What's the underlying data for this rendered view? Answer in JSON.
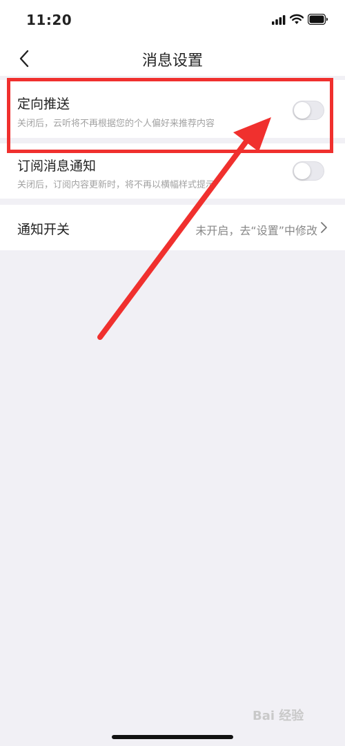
{
  "status": {
    "time": "11:20"
  },
  "nav": {
    "title": "消息设置"
  },
  "settings": {
    "targeted_push": {
      "title": "定向推送",
      "desc": "关闭后，云听将不再根据您的个人偏好来推荐内容",
      "enabled": false
    },
    "subscription_notice": {
      "title": "订阅消息通知",
      "desc": "关闭后，订阅内容更新时，将不再以横幅样式提示",
      "enabled": false
    },
    "notification_switch": {
      "title": "通知开关",
      "value": "未开启，去“设置”中修改"
    }
  },
  "annotation": {
    "color": "#f0302e"
  },
  "watermark": {
    "text": "Bai 经验"
  },
  "icons": [
    "signal-icon",
    "wifi-icon",
    "battery-icon",
    "back-arrow-icon",
    "chevron-right-icon"
  ]
}
